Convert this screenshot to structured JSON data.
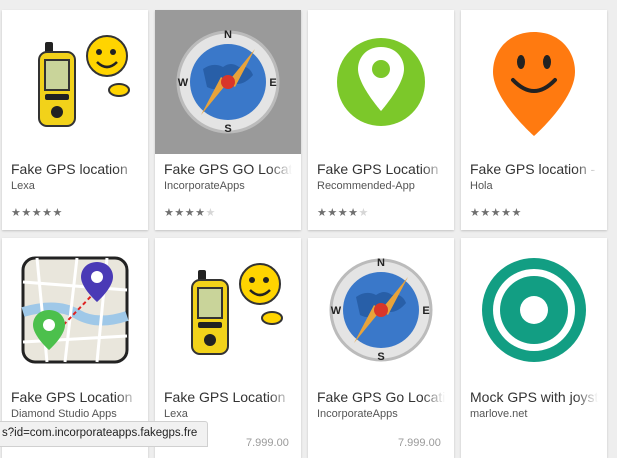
{
  "apps": [
    {
      "title": "Fake GPS location",
      "developer": "Lexa",
      "rating": 4.5,
      "icon": "gps-device-smiley-icon"
    },
    {
      "title": "Fake GPS GO Location",
      "developer": "IncorporateApps",
      "rating": 4.0,
      "icon": "compass-icon"
    },
    {
      "title": "Fake GPS Location",
      "developer": "Recommended-App",
      "rating": 4.0,
      "icon": "location-pin-icon"
    },
    {
      "title": "Fake GPS location -",
      "developer": "Hola",
      "rating": 4.5,
      "icon": "smiley-pin-icon"
    },
    {
      "title": "Fake GPS Location",
      "developer": "Diamond Studio Apps",
      "rating": null,
      "icon": "map-pins-icon"
    },
    {
      "title": "Fake GPS Location",
      "developer": "Lexa",
      "rating": null,
      "icon": "gps-device-smiley-icon"
    },
    {
      "title": "Fake GPS Go Location",
      "developer": "IncorporateApps",
      "rating": null,
      "icon": "compass-icon"
    },
    {
      "title": "Mock GPS with joystick",
      "developer": "marlove.net",
      "rating": null,
      "icon": "target-ring-icon"
    }
  ],
  "status_bar": {
    "url": "s?id=com.incorporateapps.fakegps.fre"
  },
  "prices": [
    "7.999.00",
    "7.999.00"
  ],
  "colors": {
    "star_filled": "#6f6f6f",
    "star_empty": "#d6d6d6",
    "green": "#7cc82a",
    "orange": "#ff7a10",
    "teal": "#129e83"
  }
}
